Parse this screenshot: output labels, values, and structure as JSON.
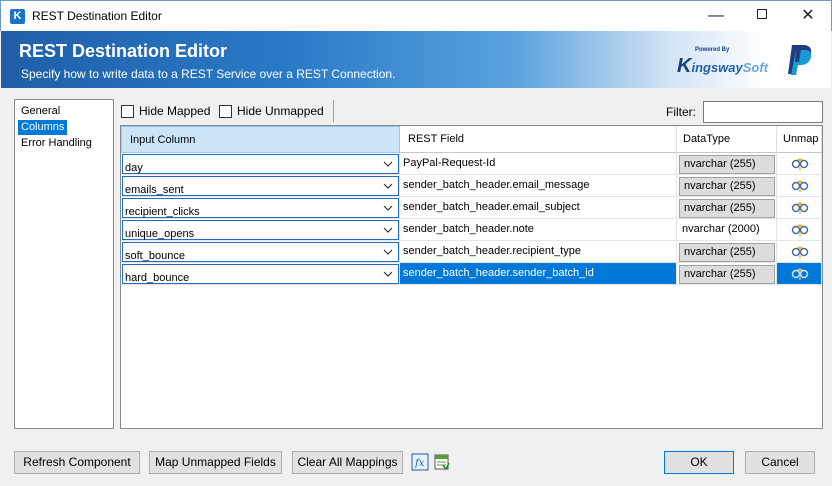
{
  "window": {
    "title": "REST Destination Editor",
    "app_icon_glyph": "K",
    "minimize_glyph": "—",
    "close_glyph": "✕"
  },
  "banner": {
    "title": "REST Destination Editor",
    "subtitle": "Specify how to write data to a REST Service over a REST Connection.",
    "logo_powered": "Powered By",
    "logo_k": "K",
    "logo_ingsway": "ingsway",
    "logo_soft": "Soft"
  },
  "nav": {
    "items": [
      {
        "label": "General",
        "selected": false
      },
      {
        "label": "Columns",
        "selected": true
      },
      {
        "label": "Error Handling",
        "selected": false
      }
    ]
  },
  "toolbar": {
    "hide_mapped_label": "Hide Mapped",
    "hide_unmapped_label": "Hide Unmapped",
    "filter_label": "Filter:",
    "filter_value": ""
  },
  "grid": {
    "columns": [
      "Input Column",
      "REST Field",
      "DataType",
      "Unmap"
    ],
    "rows": [
      {
        "input": "day",
        "field": "PayPal-Request-Id",
        "datatype": "nvarchar (255)"
      },
      {
        "input": "emails_sent",
        "field": "sender_batch_header.email_message",
        "datatype": "nvarchar (255)"
      },
      {
        "input": "recipient_clicks",
        "field": "sender_batch_header.email_subject",
        "datatype": "nvarchar (255)"
      },
      {
        "input": "unique_opens",
        "field": "sender_batch_header.note",
        "datatype": "nvarchar (2000)"
      },
      {
        "input": "soft_bounce",
        "field": "sender_batch_header.recipient_type",
        "datatype": "nvarchar (255)"
      },
      {
        "input": "hard_bounce",
        "field": "sender_batch_header.sender_batch_id",
        "datatype": "nvarchar (255)"
      }
    ]
  },
  "buttons": {
    "refresh": "Refresh Component",
    "map_unmapped": "Map Unmapped Fields",
    "clear_all": "Clear All Mappings",
    "ok": "OK",
    "cancel": "Cancel"
  },
  "colors": {
    "accent": "#0078d7",
    "banner": "#1f5fa8"
  }
}
